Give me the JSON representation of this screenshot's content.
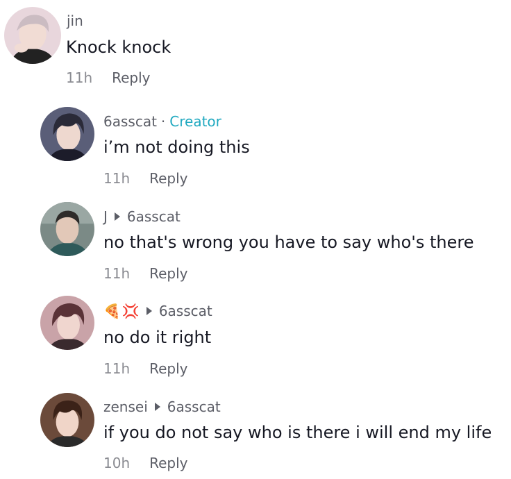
{
  "comments": [
    {
      "username": "jin",
      "text": "Knock knock",
      "time": "11h",
      "reply_label": "Reply",
      "avatar_colors": {
        "bg": "#e8d6dc",
        "hair": "#d9cbd0",
        "skin": "#f1dcd4",
        "shirt": "#222"
      }
    },
    {
      "username": "6asscat",
      "badge_separator": "·",
      "badge": "Creator",
      "text": "i’m not doing this",
      "time": "11h",
      "reply_label": "Reply",
      "avatar_colors": {
        "bg": "#5a5e78",
        "hair": "#2a2a38",
        "skin": "#eed8cf",
        "shirt": "#1c1c2a"
      }
    },
    {
      "username": "J",
      "reply_to": "6asscat",
      "text": "no that's wrong you have to say who's there",
      "time": "11h",
      "reply_label": "Reply",
      "avatar_colors": {
        "bg": "#7b8a86",
        "hair": "#2e2b29",
        "skin": "#e2c8b8",
        "shirt": "#2e5a5a"
      }
    },
    {
      "username_emojis": [
        "🍕",
        "💢"
      ],
      "reply_to": "6asscat",
      "text": "no do it right",
      "time": "11h",
      "reply_label": "Reply",
      "avatar_colors": {
        "bg": "#c9a3a8",
        "hair": "#5a3237",
        "skin": "#f0d6cf",
        "shirt": "#3a2a2e"
      }
    },
    {
      "username": "zensei",
      "reply_to": "6asscat",
      "text": "if you do not say who is there i will end my life",
      "time": "10h",
      "reply_label": "Reply",
      "avatar_colors": {
        "bg": "#6b4a3a",
        "hair": "#3b2218",
        "skin": "#f0d5c8",
        "shirt": "#2a2a2a"
      }
    }
  ]
}
